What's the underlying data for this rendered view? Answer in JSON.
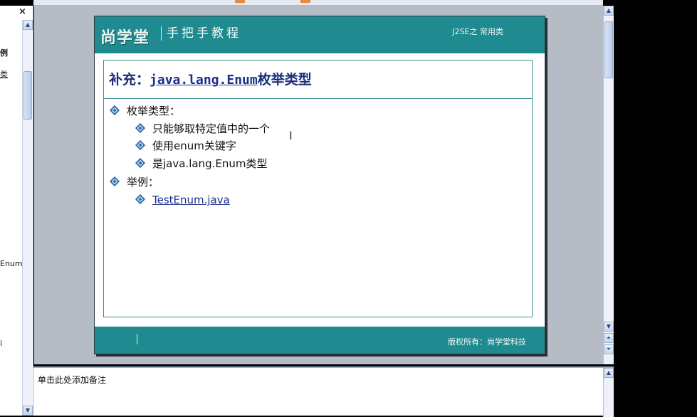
{
  "outline": {
    "close_label": "×",
    "fragments": [
      "例",
      "类",
      "Enum",
      "i"
    ]
  },
  "slide": {
    "logo": "尚学堂",
    "slogan": "手把手教程",
    "course_tag": "J2SE之 常用类",
    "title_prefix": "补充：",
    "title_code": "java.lang.Enum",
    "title_suffix": "枚举类型",
    "bullets": [
      {
        "level": 1,
        "text": "枚举类型："
      },
      {
        "level": 2,
        "text": "只能够取特定值中的一个"
      },
      {
        "level": 2,
        "text": "使用enum关键字"
      },
      {
        "level": 2,
        "text": "是java.lang.Enum类型"
      },
      {
        "level": 1,
        "text": "举例："
      },
      {
        "level": 2,
        "text": "TestEnum.java"
      }
    ],
    "copyright": "版权所有：尚学堂科技"
  },
  "notes": {
    "placeholder": "单击此处添加备注"
  },
  "colors": {
    "header_teal": "#1f8a8f",
    "title_navy": "#1b2c7a",
    "bullet_blue": "#2d6fb0"
  }
}
